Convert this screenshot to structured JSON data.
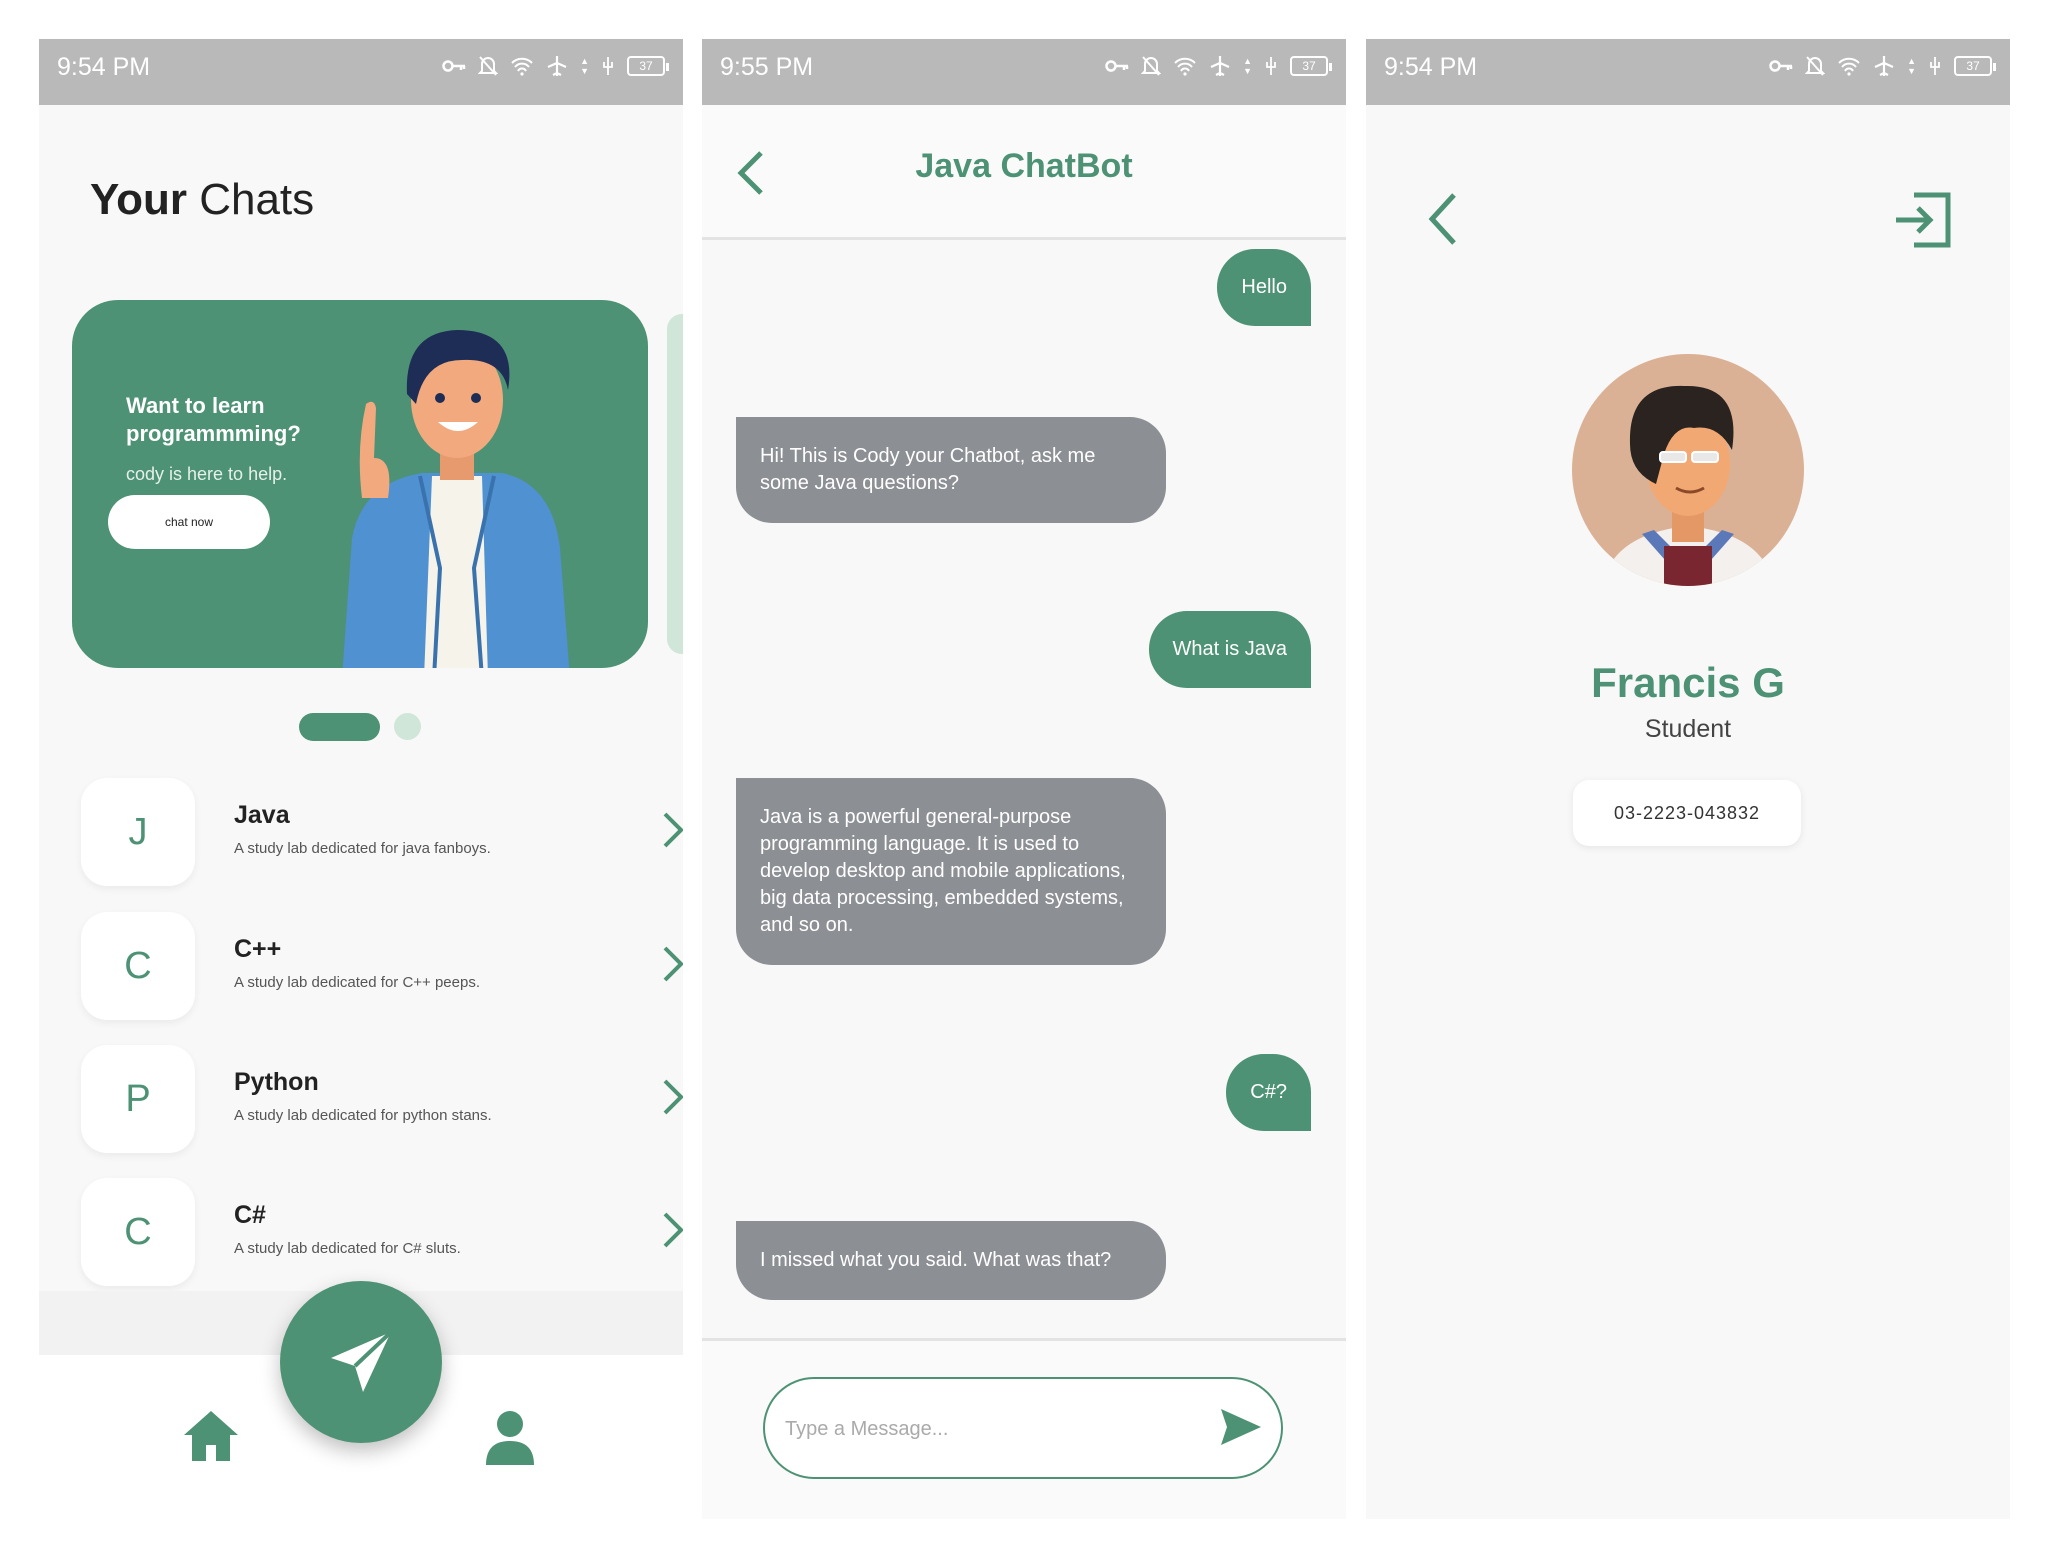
{
  "colors": {
    "accent": "#4d9274",
    "accent_light": "#cfe6d9",
    "bot_bubble": "#8c8f94",
    "statusbar": "#b9b9b9"
  },
  "screen1": {
    "status_time": "9:54 PM",
    "battery": "37",
    "title_bold": "Your",
    "title_rest": "Chats",
    "banner": {
      "title": "Want to learn programmming?",
      "subtitle": "cody is here to help.",
      "button_label": "chat now"
    },
    "chats": [
      {
        "letter": "J",
        "name": "Java",
        "description": "A study lab dedicated for java fanboys."
      },
      {
        "letter": "C",
        "name": "C++",
        "description": "A study lab dedicated for C++ peeps."
      },
      {
        "letter": "P",
        "name": "Python",
        "description": "A study lab dedicated for python stans."
      },
      {
        "letter": "C",
        "name": "C#",
        "description": "A study lab dedicated for C# sluts."
      }
    ],
    "nav": {
      "home_icon": "home-icon",
      "send_icon": "paper-plane-icon",
      "profile_icon": "user-icon"
    }
  },
  "screen2": {
    "status_time": "9:55 PM",
    "battery": "37",
    "title": "Java ChatBot",
    "messages": [
      {
        "from": "user",
        "text": "Hello"
      },
      {
        "from": "bot",
        "text": "Hi! This is Cody your Chatbot, ask me some Java questions?"
      },
      {
        "from": "user",
        "text": "What is Java"
      },
      {
        "from": "bot",
        "text": "Java is a powerful general-purpose programming language. It is used to develop desktop and mobile applications, big data processing, embedded systems, and so on."
      },
      {
        "from": "user",
        "text": "C#?"
      },
      {
        "from": "bot",
        "text": "I missed what you said. What was that?"
      }
    ],
    "input_placeholder": "Type a Message..."
  },
  "screen3": {
    "status_time": "9:54 PM",
    "battery": "37",
    "name": "Francis G",
    "role": "Student",
    "phone": "03-2223-043832"
  }
}
